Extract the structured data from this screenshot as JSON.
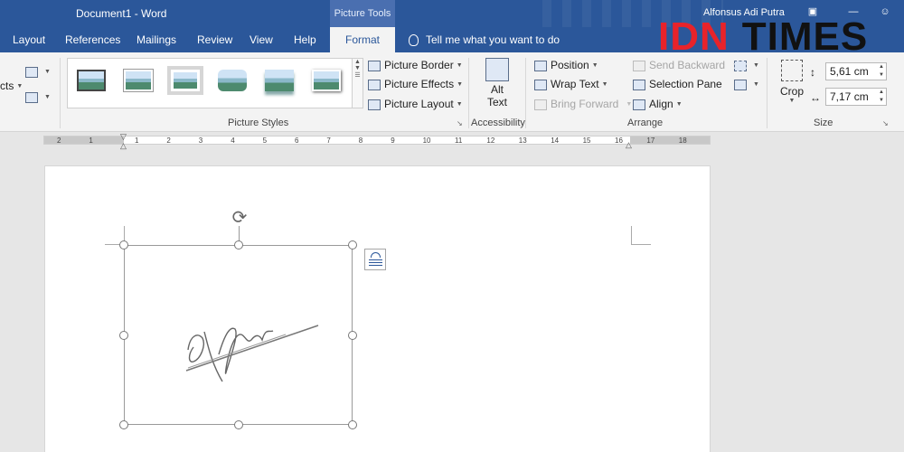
{
  "window": {
    "doc_title": "Document1  -  Word",
    "context_group": "Picture Tools",
    "user": "Alfonsus Adi Putra"
  },
  "watermark": {
    "part1": "IDN",
    "part2": "TIMES"
  },
  "tabs": [
    {
      "label": "Layout"
    },
    {
      "label": "References"
    },
    {
      "label": "Mailings"
    },
    {
      "label": "Review"
    },
    {
      "label": "View"
    },
    {
      "label": "Help"
    },
    {
      "label": "Format"
    }
  ],
  "tell_me": "Tell me what you want to do",
  "ribbon": {
    "adjust_fragment": "cts",
    "picture_styles": {
      "label": "Picture Styles",
      "border": "Picture Border",
      "effects": "Picture Effects",
      "layout": "Picture Layout"
    },
    "accessibility": {
      "label": "Accessibility",
      "alt_line1": "Alt",
      "alt_line2": "Text"
    },
    "arrange": {
      "label": "Arrange",
      "position": "Position",
      "wrap_text": "Wrap Text",
      "bring_forward": "Bring Forward",
      "send_backward": "Send Backward",
      "selection_pane": "Selection Pane",
      "align": "Align"
    },
    "size": {
      "label": "Size",
      "crop": "Crop",
      "height": "5,61 cm",
      "width": "7,17 cm"
    }
  },
  "ruler": {
    "ticks": [
      "2",
      "1",
      "1",
      "2",
      "3",
      "4",
      "5",
      "6",
      "7",
      "8",
      "9",
      "10",
      "11",
      "12",
      "13",
      "14",
      "15",
      "16",
      "17",
      "18"
    ]
  },
  "signature_text": "Alfons"
}
